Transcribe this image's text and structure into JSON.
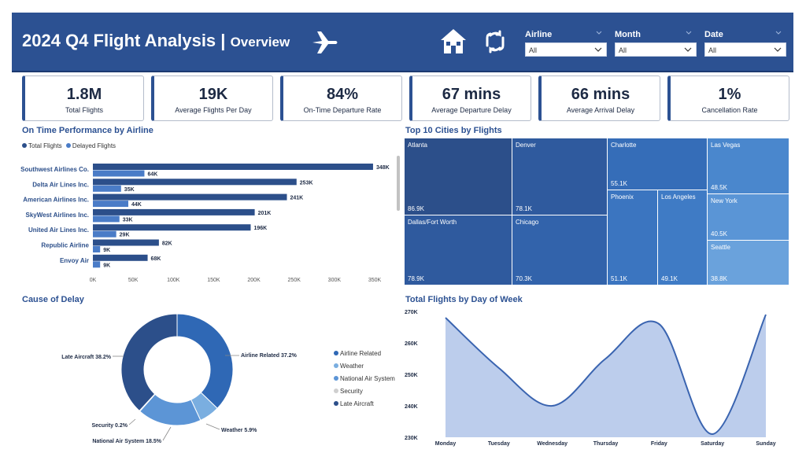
{
  "header": {
    "title": "2024 Q4 Flight Analysis",
    "separator": "|",
    "subtitle": "Overview",
    "plane_icon": "airplane-icon",
    "home_icon": "home-icon",
    "refresh_icon": "refresh-icon",
    "slicers": [
      {
        "label": "Airline",
        "value": "All"
      },
      {
        "label": "Month",
        "value": "All"
      },
      {
        "label": "Date",
        "value": "All"
      }
    ]
  },
  "kpis": [
    {
      "value": "1.8M",
      "label": "Total Flights"
    },
    {
      "value": "19K",
      "label": "Average Flights Per Day"
    },
    {
      "value": "84%",
      "label": "On-Time Departure Rate"
    },
    {
      "value": "67 mins",
      "label": "Average Departure Delay"
    },
    {
      "value": "66 mins",
      "label": "Average Arrival Delay"
    },
    {
      "value": "1%",
      "label": "Cancellation Rate"
    }
  ],
  "colors": {
    "header": "#2c5192",
    "total": "#2c4f8a",
    "delayed": "#4a7cc7",
    "area_fill": "#bccdec",
    "area_line": "#3a64b0"
  },
  "sections": {
    "otp_title": "On Time Performance by Airline",
    "cities_title": "Top 10 Cities by Flights",
    "delay_title": "Cause of Delay",
    "dow_title": "Total Flights by Day of Week"
  },
  "otp_legend": [
    "Total Flights",
    "Delayed Flights"
  ],
  "chart_data": [
    {
      "type": "bar",
      "title": "On Time Performance by Airline",
      "categories": [
        "Southwest Airlines Co.",
        "Delta Air Lines Inc.",
        "American Airlines Inc.",
        "SkyWest Airlines Inc.",
        "United Air Lines Inc.",
        "Republic Airline",
        "Envoy Air"
      ],
      "series": [
        {
          "name": "Total Flights",
          "values": [
            348,
            253,
            241,
            201,
            196,
            82,
            68
          ],
          "labels": [
            "348K",
            "253K",
            "241K",
            "201K",
            "196K",
            "82K",
            "68K"
          ]
        },
        {
          "name": "Delayed Flights",
          "values": [
            64,
            35,
            44,
            33,
            29,
            9,
            9
          ],
          "labels": [
            "64K",
            "35K",
            "44K",
            "33K",
            "29K",
            "9K",
            "9K"
          ]
        }
      ],
      "xticks": [
        "0K",
        "50K",
        "100K",
        "150K",
        "200K",
        "250K",
        "300K",
        "350K"
      ],
      "xlim": [
        0,
        350
      ]
    },
    {
      "type": "treemap",
      "title": "Top 10 Cities by Flights",
      "items": [
        {
          "name": "Atlanta",
          "value": "86.9K"
        },
        {
          "name": "Dallas/Fort Worth",
          "value": "78.9K"
        },
        {
          "name": "Denver",
          "value": "78.1K"
        },
        {
          "name": "Chicago",
          "value": "70.3K"
        },
        {
          "name": "Charlotte",
          "value": "55.1K"
        },
        {
          "name": "Phoenix",
          "value": "51.1K"
        },
        {
          "name": "Los Angeles",
          "value": "49.1K"
        },
        {
          "name": "Las Vegas",
          "value": "48.5K"
        },
        {
          "name": "New York",
          "value": "40.5K"
        },
        {
          "name": "Seattle",
          "value": "38.8K"
        }
      ]
    },
    {
      "type": "pie",
      "title": "Cause of Delay",
      "slices": [
        {
          "name": "Airline Related",
          "value": 37.2,
          "label": "Airline Related 37.2%",
          "color": "#2f68b5"
        },
        {
          "name": "Weather",
          "value": 5.9,
          "label": "Weather 5.9%",
          "color": "#7aaee0"
        },
        {
          "name": "National Air System",
          "value": 18.5,
          "label": "National Air System 18.5%",
          "color": "#5c95d6"
        },
        {
          "name": "Security",
          "value": 0.2,
          "label": "Security 0.2%",
          "color": "#cfcfcf"
        },
        {
          "name": "Late Aircraft",
          "value": 38.2,
          "label": "Late Aircraft 38.2%",
          "color": "#2c4f8a"
        }
      ],
      "legend": [
        "Airline Related",
        "Weather",
        "National Air System",
        "Security",
        "Late Aircraft"
      ]
    },
    {
      "type": "area",
      "title": "Total Flights by Day of Week",
      "categories": [
        "Monday",
        "Tuesday",
        "Wednesday",
        "Thursday",
        "Friday",
        "Saturday",
        "Sunday"
      ],
      "values": [
        268,
        252,
        240,
        255,
        266,
        231,
        269
      ],
      "yticks": [
        "270K",
        "260K",
        "250K",
        "240K",
        "230K"
      ],
      "ylim": [
        230,
        270
      ]
    }
  ]
}
